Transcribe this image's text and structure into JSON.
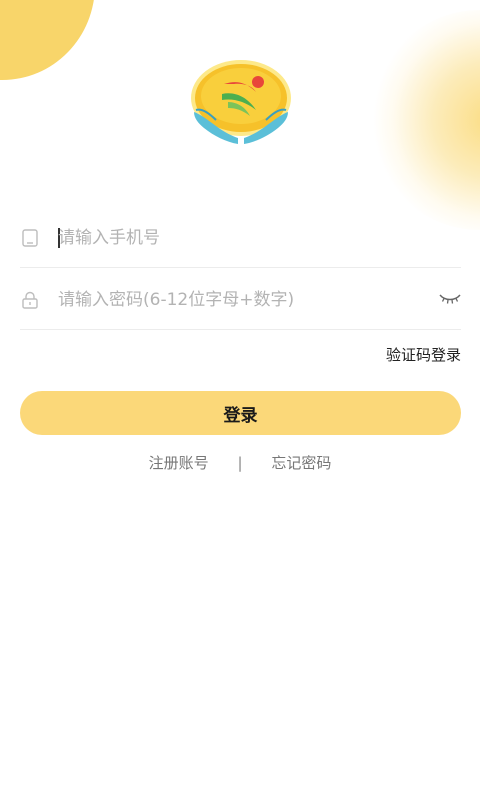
{
  "form": {
    "phone_placeholder": "请输入手机号",
    "password_placeholder": "请输入密码(6-12位字母+数字)",
    "sms_login_label": "验证码登录"
  },
  "actions": {
    "login_label": "登录",
    "register_label": "注册账号",
    "separator": "|",
    "forgot_label": "忘记密码"
  },
  "icons": {
    "phone": "phone-icon",
    "lock": "lock-icon",
    "eye": "eye-closed-icon",
    "logo": "app-logo"
  },
  "colors": {
    "accent": "#fbd879",
    "blob": "#f8d56a",
    "placeholder": "#b3b3b3",
    "divider": "#ececec"
  }
}
